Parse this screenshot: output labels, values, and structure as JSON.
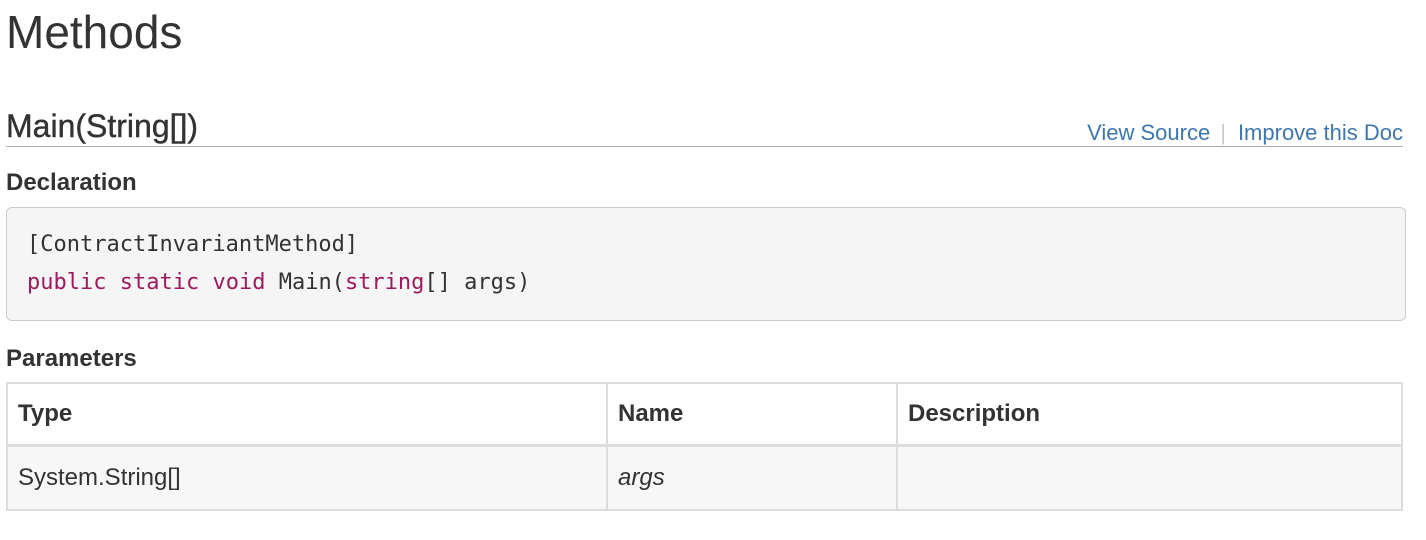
{
  "page": {
    "section_title": "Methods"
  },
  "method": {
    "name": "Main(String[])",
    "links": {
      "view_source": "View Source",
      "separator": "|",
      "improve_doc": "Improve this Doc"
    }
  },
  "declaration": {
    "heading": "Declaration",
    "line1": "[ContractInvariantMethod]",
    "line2_tokens": {
      "public": "public",
      "static": "static",
      "void": "void",
      "name": "Main(",
      "string": "string",
      "rest": "[] args)"
    }
  },
  "parameters": {
    "heading": "Parameters",
    "headers": {
      "type": "Type",
      "name": "Name",
      "description": "Description"
    },
    "rows": [
      {
        "type": "System.String[]",
        "name": "args",
        "description": ""
      }
    ]
  },
  "colors": {
    "link": "#3d77b3",
    "keyword": "#a0195d",
    "code_background": "#f5f5f5"
  }
}
